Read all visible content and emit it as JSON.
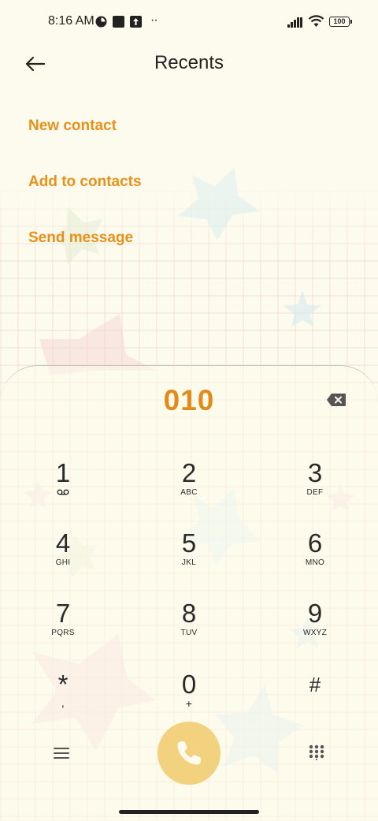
{
  "status_bar": {
    "time": "8:16 AM",
    "battery_level": "100",
    "overflow": "··"
  },
  "header": {
    "title": "Recents"
  },
  "actions": [
    "New contact",
    "Add to contacts",
    "Send message"
  ],
  "dialer": {
    "number": "010",
    "keys": [
      {
        "digit": "1",
        "letters": ""
      },
      {
        "digit": "2",
        "letters": "ABC"
      },
      {
        "digit": "3",
        "letters": "DEF"
      },
      {
        "digit": "4",
        "letters": "GHI"
      },
      {
        "digit": "5",
        "letters": "JKL"
      },
      {
        "digit": "6",
        "letters": "MNO"
      },
      {
        "digit": "7",
        "letters": "PQRS"
      },
      {
        "digit": "8",
        "letters": "TUV"
      },
      {
        "digit": "9",
        "letters": "WXYZ"
      },
      {
        "digit": "*",
        "letters": ","
      },
      {
        "digit": "0",
        "letters": "+"
      },
      {
        "digit": "#",
        "letters": ""
      }
    ]
  },
  "icons": {
    "back": "back-arrow-icon",
    "backspace": "backspace-icon",
    "voicemail": "voicemail-icon",
    "menu": "menu-icon",
    "call": "phone-icon",
    "dialpad": "dialpad-icon"
  },
  "colors": {
    "accent": "#e8911a",
    "call_button": "#f2d27f",
    "background": "#fdfbee"
  }
}
